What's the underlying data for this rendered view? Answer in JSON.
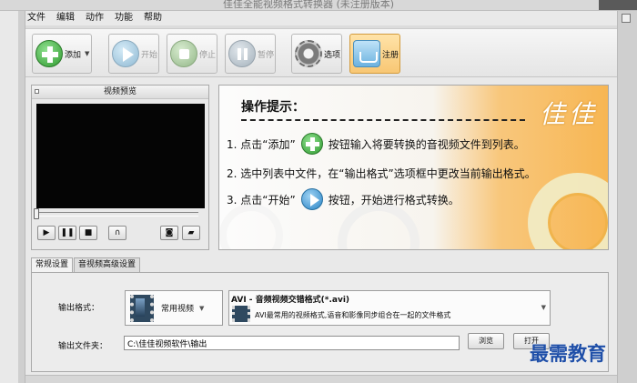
{
  "window": {
    "title": "佳佳全能视频格式转换器 (未注册版本)"
  },
  "menu": [
    "文件",
    "编辑",
    "动作",
    "功能",
    "帮助"
  ],
  "toolbar": {
    "add_label": "添加",
    "start_label": "开始",
    "stop_label": "停止",
    "pause_label": "暂停",
    "options_label": "选项",
    "register_label": "注册"
  },
  "preview": {
    "title": "视频预览",
    "progress": 0
  },
  "hint": {
    "title": "操作提示：",
    "brand": "佳佳",
    "step1_a": "1. 点击“添加”",
    "step1_b": "按钮输入将要转换的音视频文件到列表。",
    "step2": "2. 选中列表中文件，在“输出格式”选项框中更改当前输出格式。",
    "step3_a": "3. 点击“开始”",
    "step3_b": "按钮，开始进行格式转换。"
  },
  "tabs": [
    "常规设置",
    "音视频高级设置"
  ],
  "settings": {
    "output_format_label": "输出格式：",
    "category": "常用视频",
    "format_title": "AVI - 音频视频交错格式(*.avi)",
    "format_desc": "AVI最常用的视频格式,语音和影像同步组合在一起的文件格式",
    "output_dir_label": "输出文件夹：",
    "output_dir_value": "C:\\佳佳视频软件\\输出",
    "browse_label": "浏览",
    "open_label": "打开"
  },
  "watermark": "最需教育"
}
